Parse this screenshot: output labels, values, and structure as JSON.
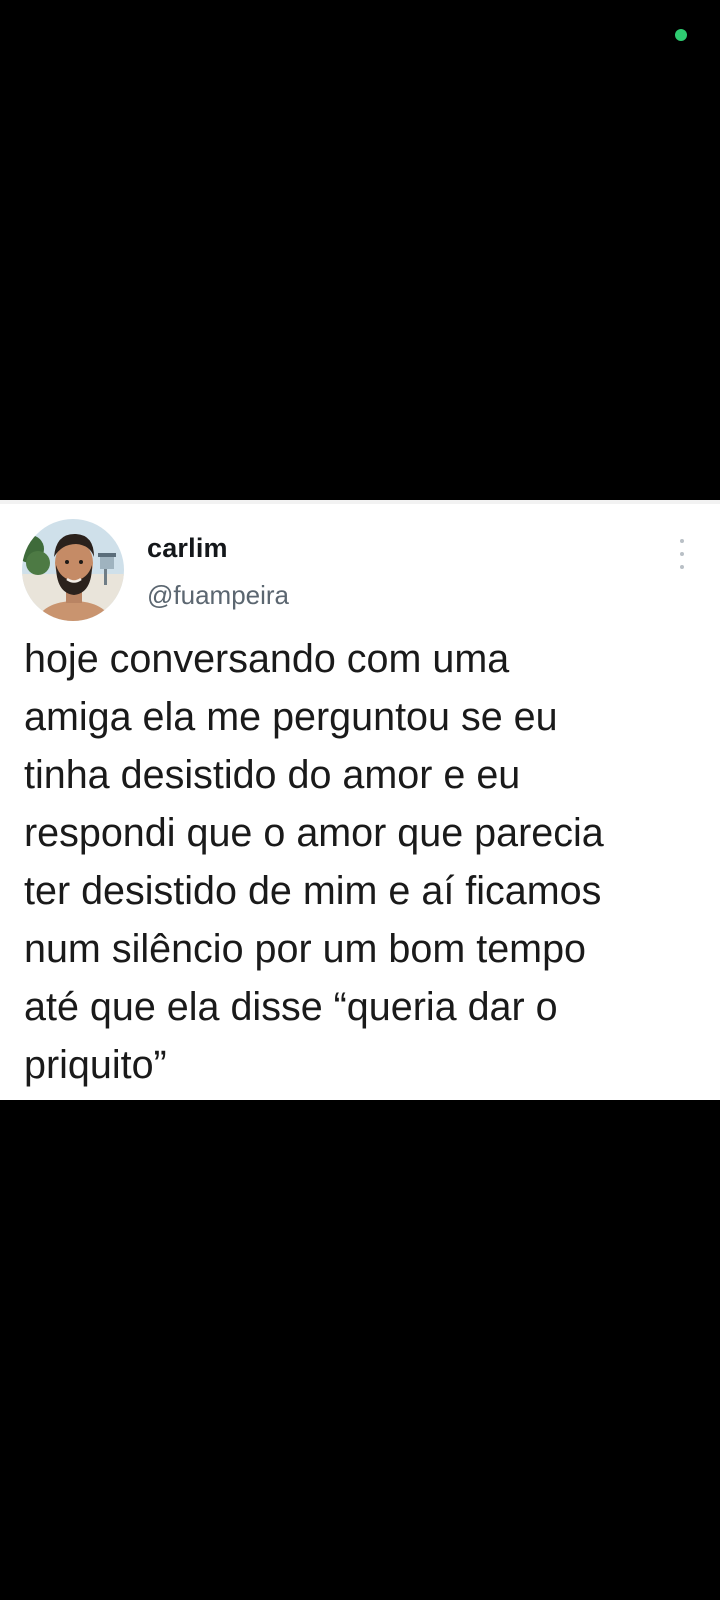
{
  "status": {
    "camera_indicator_color": "#2ecc71"
  },
  "tweet": {
    "avatar_icon": "profile-photo",
    "display_name": "carlim",
    "handle": "@fuampeira",
    "more_icon": "vertical-ellipsis-icon",
    "text": "hoje conversando com uma\namiga ela me perguntou se eu\ntinha desistido do amor e eu\nrespondi que o amor que parecia\nter desistido de mim e aí ficamos\nnum silêncio por um bom tempo\naté que ela disse “queria dar o\npriquito”"
  },
  "colors": {
    "background": "#000000",
    "card": "#ffffff",
    "name": "#14171a",
    "handle": "#5b6670",
    "text": "#1a1a1a"
  }
}
